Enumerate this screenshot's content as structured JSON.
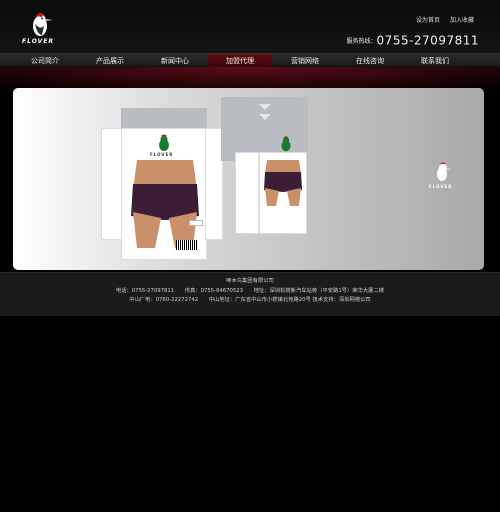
{
  "brand": {
    "logo_text": "FLOVER"
  },
  "top_links": {
    "home": "设为首页",
    "favorite": "加入收藏"
  },
  "hotline": {
    "label": "服务热线：",
    "number": "0755-27097811"
  },
  "nav": {
    "items": [
      {
        "label": "公司简介"
      },
      {
        "label": "产品展示"
      },
      {
        "label": "新闻中心"
      },
      {
        "label": "加盟代理"
      },
      {
        "label": "营销网络"
      },
      {
        "label": "在线咨询"
      },
      {
        "label": "联系我们"
      }
    ],
    "active_index": 3
  },
  "banner": {
    "box_label": "FLOVER"
  },
  "footer": {
    "company": "啄木鸟集团有限公司",
    "line2": "电话：0755-27097811　　传真：0755-84670523　　地址：深圳松岗新汽车站旁（平安路1号）荣华大厦二楼",
    "line3": "中山厂电：0760-22272742　　中山地址：广东省中山市小榄镇北苑路20号 技术支持：深圳网络公司"
  },
  "colors": {
    "accent": "#5a0b12",
    "background": "#000000",
    "hotline": "#eeeeee"
  }
}
